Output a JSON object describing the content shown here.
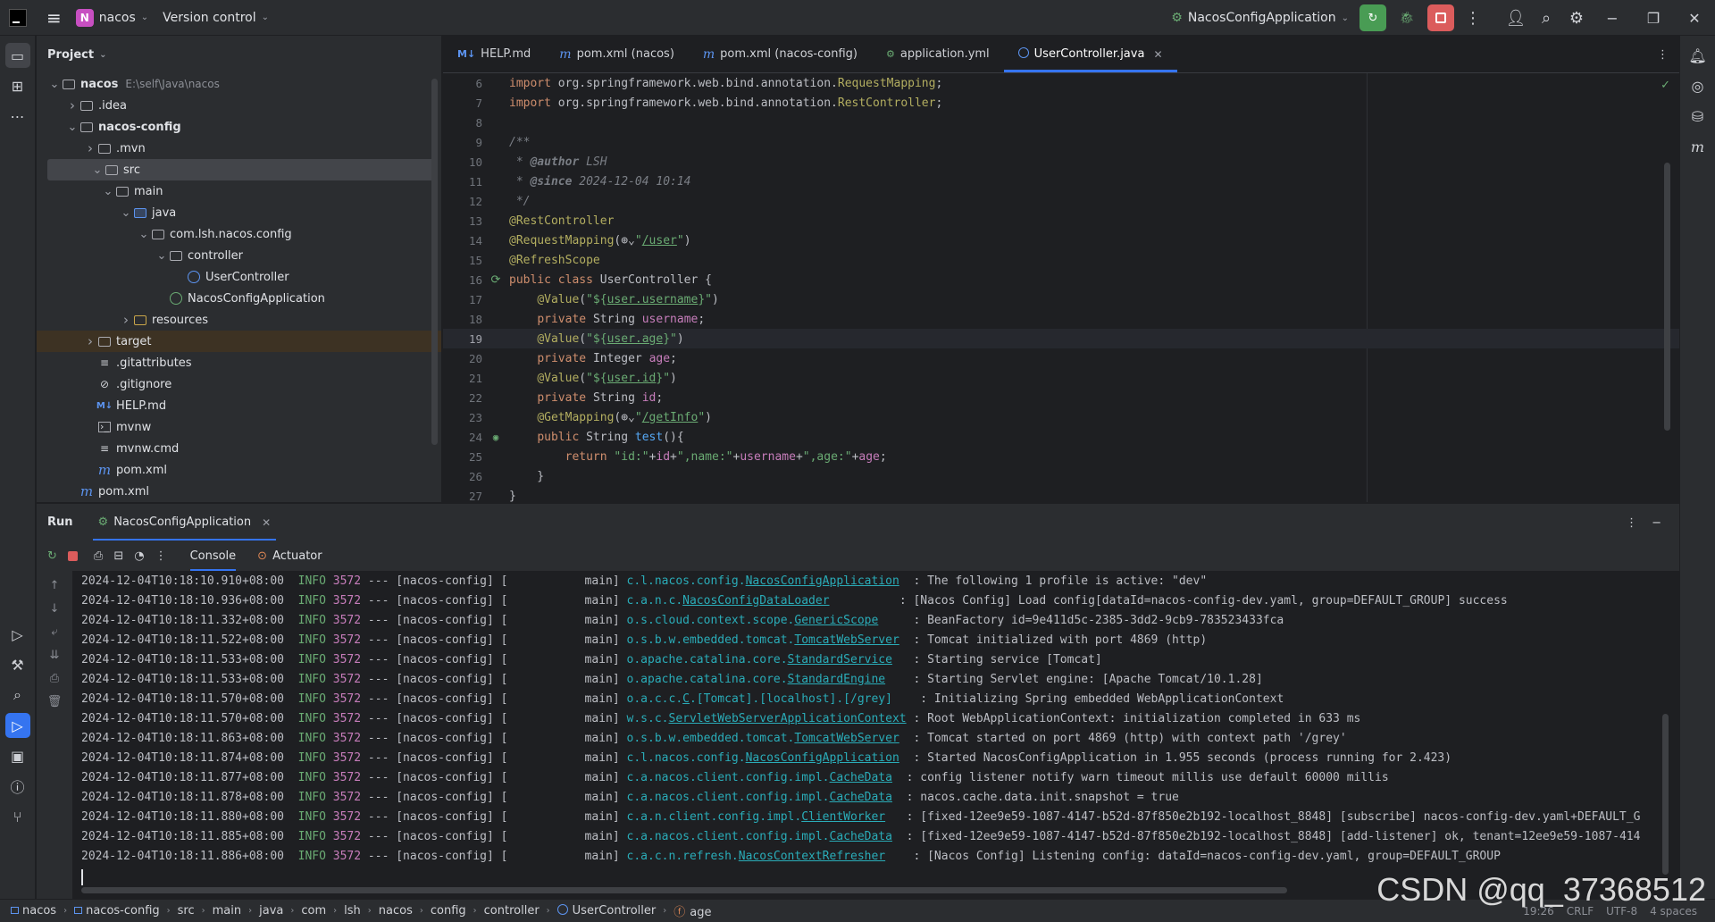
{
  "titlebar": {
    "project_badge": "N",
    "project_name": "nacos",
    "vcs": "Version control",
    "run_config": "NacosConfigApplication"
  },
  "project_panel": {
    "title": "Project",
    "tree": [
      {
        "label": "nacos",
        "hint": "E:\\self\\Java\\nacos",
        "depth": 0,
        "arrow": "open",
        "icon": "module-folder",
        "bold": true
      },
      {
        "label": ".idea",
        "depth": 1,
        "arrow": "closed",
        "icon": "folder"
      },
      {
        "label": "nacos-config",
        "depth": 1,
        "arrow": "open",
        "icon": "module-folder",
        "bold": true
      },
      {
        "label": ".mvn",
        "depth": 2,
        "arrow": "closed",
        "icon": "folder"
      },
      {
        "label": "src",
        "depth": 2,
        "arrow": "open",
        "icon": "folder",
        "selected": true
      },
      {
        "label": "main",
        "depth": 3,
        "arrow": "open",
        "icon": "folder"
      },
      {
        "label": "java",
        "depth": 4,
        "arrow": "open",
        "icon": "source-folder"
      },
      {
        "label": "com.lsh.nacos.config",
        "depth": 5,
        "arrow": "open",
        "icon": "package"
      },
      {
        "label": "controller",
        "depth": 6,
        "arrow": "open",
        "icon": "package"
      },
      {
        "label": "UserController",
        "depth": 7,
        "arrow": "",
        "icon": "class"
      },
      {
        "label": "NacosConfigApplication",
        "depth": 6,
        "arrow": "",
        "icon": "spring-class"
      },
      {
        "label": "resources",
        "depth": 4,
        "arrow": "closed",
        "icon": "resources-folder"
      },
      {
        "label": "target",
        "depth": 2,
        "arrow": "closed",
        "icon": "folder",
        "excluded": true
      },
      {
        "label": ".gitattributes",
        "depth": 2,
        "arrow": "",
        "icon": "text-file"
      },
      {
        "label": ".gitignore",
        "depth": 2,
        "arrow": "",
        "icon": "ignore-file"
      },
      {
        "label": "HELP.md",
        "depth": 2,
        "arrow": "",
        "icon": "markdown-file"
      },
      {
        "label": "mvnw",
        "depth": 2,
        "arrow": "",
        "icon": "script-file"
      },
      {
        "label": "mvnw.cmd",
        "depth": 2,
        "arrow": "",
        "icon": "text-file"
      },
      {
        "label": "pom.xml",
        "depth": 2,
        "arrow": "",
        "icon": "maven-file"
      },
      {
        "label": "pom.xml",
        "depth": 1,
        "arrow": "",
        "icon": "maven-file"
      }
    ]
  },
  "editor": {
    "tabs": [
      {
        "label": "HELP.md",
        "icon": "M↓",
        "active": false
      },
      {
        "label": "pom.xml (nacos)",
        "icon": "m",
        "active": false
      },
      {
        "label": "pom.xml (nacos-config)",
        "icon": "m",
        "active": false
      },
      {
        "label": "application.yml",
        "icon": "yml",
        "active": false
      },
      {
        "label": "UserController.java",
        "icon": "class",
        "active": true
      }
    ],
    "lines": [
      {
        "n": "6",
        "parts": [
          [
            "kw",
            "import "
          ],
          [
            "plain",
            "org.springframework.web.bind.annotation."
          ],
          [
            "ann",
            "RequestMapping"
          ],
          [
            "plain",
            ";"
          ]
        ]
      },
      {
        "n": "7",
        "parts": [
          [
            "kw",
            "import "
          ],
          [
            "plain",
            "org.springframework.web.bind.annotation."
          ],
          [
            "ann",
            "RestController"
          ],
          [
            "plain",
            ";"
          ]
        ]
      },
      {
        "n": "8",
        "parts": []
      },
      {
        "n": "9",
        "parts": [
          [
            "cmt",
            "/**"
          ]
        ]
      },
      {
        "n": "10",
        "parts": [
          [
            "cmt",
            " * "
          ],
          [
            "tag",
            "@author"
          ],
          [
            "cmt",
            " LSH"
          ]
        ]
      },
      {
        "n": "11",
        "parts": [
          [
            "cmt",
            " * "
          ],
          [
            "tag",
            "@since"
          ],
          [
            "cmt",
            " 2024-12-04 10:14"
          ]
        ]
      },
      {
        "n": "12",
        "parts": [
          [
            "cmt",
            " */"
          ]
        ]
      },
      {
        "n": "13",
        "parts": [
          [
            "ann",
            "@RestController"
          ]
        ]
      },
      {
        "n": "14",
        "parts": [
          [
            "ann",
            "@RequestMapping"
          ],
          [
            "plain",
            "(⊕⌄"
          ],
          [
            "str",
            "\""
          ],
          [
            "str link",
            "/user"
          ],
          [
            "str",
            "\""
          ],
          [
            "plain",
            ")"
          ]
        ]
      },
      {
        "n": "15",
        "parts": [
          [
            "ann",
            "@RefreshScope"
          ]
        ]
      },
      {
        "n": "16",
        "gutter": "bean",
        "parts": [
          [
            "kw",
            "public class "
          ],
          [
            "plain",
            "UserController {"
          ]
        ]
      },
      {
        "n": "17",
        "parts": [
          [
            "plain",
            "    "
          ],
          [
            "ann",
            "@Value"
          ],
          [
            "plain",
            "("
          ],
          [
            "str",
            "\"${"
          ],
          [
            "str link",
            "user.username"
          ],
          [
            "str",
            "}\""
          ],
          [
            "plain",
            ")"
          ]
        ]
      },
      {
        "n": "18",
        "parts": [
          [
            "plain",
            "    "
          ],
          [
            "kw",
            "private "
          ],
          [
            "plain",
            "String "
          ],
          [
            "fld",
            "username"
          ],
          [
            "plain",
            ";"
          ]
        ]
      },
      {
        "n": "19",
        "current": true,
        "parts": [
          [
            "plain",
            "    "
          ],
          [
            "ann",
            "@Value"
          ],
          [
            "plain",
            "("
          ],
          [
            "str",
            "\"${"
          ],
          [
            "str link",
            "user.age"
          ],
          [
            "str",
            "}\""
          ],
          [
            "plain",
            ")"
          ]
        ]
      },
      {
        "n": "20",
        "parts": [
          [
            "plain",
            "    "
          ],
          [
            "kw",
            "private "
          ],
          [
            "plain",
            "Integer "
          ],
          [
            "fld",
            "age"
          ],
          [
            "plain",
            ";"
          ]
        ]
      },
      {
        "n": "21",
        "parts": [
          [
            "plain",
            "    "
          ],
          [
            "ann",
            "@Value"
          ],
          [
            "plain",
            "("
          ],
          [
            "str",
            "\"${"
          ],
          [
            "str link",
            "user.id"
          ],
          [
            "str",
            "}\""
          ],
          [
            "plain",
            ")"
          ]
        ]
      },
      {
        "n": "22",
        "parts": [
          [
            "plain",
            "    "
          ],
          [
            "kw",
            "private "
          ],
          [
            "plain",
            "String "
          ],
          [
            "fld",
            "id"
          ],
          [
            "plain",
            ";"
          ]
        ]
      },
      {
        "n": "23",
        "parts": [
          [
            "plain",
            "    "
          ],
          [
            "ann",
            "@GetMapping"
          ],
          [
            "plain",
            "(⊕⌄"
          ],
          [
            "str",
            "\""
          ],
          [
            "str link",
            "/getInfo"
          ],
          [
            "str",
            "\""
          ],
          [
            "plain",
            ")"
          ]
        ]
      },
      {
        "n": "24",
        "gutter": "endpoint",
        "parts": [
          [
            "plain",
            "    "
          ],
          [
            "kw",
            "public "
          ],
          [
            "plain",
            "String "
          ],
          [
            "fn",
            "test"
          ],
          [
            "plain",
            "(){"
          ]
        ]
      },
      {
        "n": "25",
        "parts": [
          [
            "plain",
            "        "
          ],
          [
            "kw",
            "return "
          ],
          [
            "str",
            "\"id:\""
          ],
          [
            "plain",
            "+"
          ],
          [
            "fld",
            "id"
          ],
          [
            "plain",
            "+"
          ],
          [
            "str",
            "\",name:\""
          ],
          [
            "plain",
            "+"
          ],
          [
            "fld",
            "username"
          ],
          [
            "plain",
            "+"
          ],
          [
            "str",
            "\",age:\""
          ],
          [
            "plain",
            "+"
          ],
          [
            "fld",
            "age"
          ],
          [
            "plain",
            ";"
          ]
        ]
      },
      {
        "n": "26",
        "parts": [
          [
            "plain",
            "    }"
          ]
        ]
      },
      {
        "n": "27",
        "parts": [
          [
            "plain",
            "}"
          ]
        ]
      }
    ]
  },
  "run": {
    "title": "Run",
    "tab": "NacosConfigApplication",
    "console_tab": "Console",
    "actuator_tab": "Actuator",
    "logs": [
      {
        "ts": "2024-12-04T10:18:10.910+08:00",
        "lvl": "INFO",
        "pid": "3572",
        "app": "--- [nacos-config] [",
        "thread": "           main]",
        "pre": "c.l.nacos.config.",
        "cls": "NacosConfigApplication",
        "pad": "  ",
        "msg": ": The following 1 profile is active: \"dev\""
      },
      {
        "ts": "2024-12-04T10:18:10.936+08:00",
        "lvl": "INFO",
        "pid": "3572",
        "app": "--- [nacos-config] [",
        "thread": "           main]",
        "pre": "c.a.n.c.",
        "cls": "NacosConfigDataLoader",
        "pad": "          ",
        "msg": ": [Nacos Config] Load config[dataId=nacos-config-dev.yaml, group=DEFAULT_GROUP] success"
      },
      {
        "ts": "2024-12-04T10:18:11.332+08:00",
        "lvl": "INFO",
        "pid": "3572",
        "app": "--- [nacos-config] [",
        "thread": "           main]",
        "pre": "o.s.cloud.context.scope.",
        "cls": "GenericScope",
        "pad": "     ",
        "msg": ": BeanFactory id=9e411d5c-2385-3dd2-9cb9-783523433fca"
      },
      {
        "ts": "2024-12-04T10:18:11.522+08:00",
        "lvl": "INFO",
        "pid": "3572",
        "app": "--- [nacos-config] [",
        "thread": "           main]",
        "pre": "o.s.b.w.embedded.tomcat.",
        "cls": "TomcatWebServer",
        "pad": "  ",
        "msg": ": Tomcat initialized with port 4869 (http)"
      },
      {
        "ts": "2024-12-04T10:18:11.533+08:00",
        "lvl": "INFO",
        "pid": "3572",
        "app": "--- [nacos-config] [",
        "thread": "           main]",
        "pre": "o.apache.catalina.core.",
        "cls": "StandardService",
        "pad": "   ",
        "msg": ": Starting service [Tomcat]"
      },
      {
        "ts": "2024-12-04T10:18:11.533+08:00",
        "lvl": "INFO",
        "pid": "3572",
        "app": "--- [nacos-config] [",
        "thread": "           main]",
        "pre": "o.apache.catalina.core.",
        "cls": "StandardEngine",
        "pad": "    ",
        "msg": ": Starting Servlet engine: [Apache Tomcat/10.1.28]"
      },
      {
        "ts": "2024-12-04T10:18:11.570+08:00",
        "lvl": "INFO",
        "pid": "3572",
        "app": "--- [nacos-config] [",
        "thread": "           main]",
        "pre": "o.a.c.c.",
        "cls": "C",
        "post": ".[Tomcat].[localhost].[/grey]",
        "pad": "    ",
        "msg": ": Initializing Spring embedded WebApplicationContext"
      },
      {
        "ts": "2024-12-04T10:18:11.570+08:00",
        "lvl": "INFO",
        "pid": "3572",
        "app": "--- [nacos-config] [",
        "thread": "           main]",
        "pre": "w.s.c.",
        "cls": "ServletWebServerApplicationContext",
        "pad": " ",
        "msg": ": Root WebApplicationContext: initialization completed in 633 ms"
      },
      {
        "ts": "2024-12-04T10:18:11.863+08:00",
        "lvl": "INFO",
        "pid": "3572",
        "app": "--- [nacos-config] [",
        "thread": "           main]",
        "pre": "o.s.b.w.embedded.tomcat.",
        "cls": "TomcatWebServer",
        "pad": "  ",
        "msg": ": Tomcat started on port 4869 (http) with context path '/grey'"
      },
      {
        "ts": "2024-12-04T10:18:11.874+08:00",
        "lvl": "INFO",
        "pid": "3572",
        "app": "--- [nacos-config] [",
        "thread": "           main]",
        "pre": "c.l.nacos.config.",
        "cls": "NacosConfigApplication",
        "pad": "  ",
        "msg": ": Started NacosConfigApplication in 1.955 seconds (process running for 2.423)"
      },
      {
        "ts": "2024-12-04T10:18:11.877+08:00",
        "lvl": "INFO",
        "pid": "3572",
        "app": "--- [nacos-config] [",
        "thread": "           main]",
        "pre": "c.a.nacos.client.config.impl.",
        "cls": "CacheData",
        "pad": "  ",
        "msg": ": config listener notify warn timeout millis use default 60000 millis"
      },
      {
        "ts": "2024-12-04T10:18:11.878+08:00",
        "lvl": "INFO",
        "pid": "3572",
        "app": "--- [nacos-config] [",
        "thread": "           main]",
        "pre": "c.a.nacos.client.config.impl.",
        "cls": "CacheData",
        "pad": "  ",
        "msg": ": nacos.cache.data.init.snapshot = true"
      },
      {
        "ts": "2024-12-04T10:18:11.880+08:00",
        "lvl": "INFO",
        "pid": "3572",
        "app": "--- [nacos-config] [",
        "thread": "           main]",
        "pre": "c.a.n.client.config.impl.",
        "cls": "ClientWorker",
        "pad": "   ",
        "msg": ": [fixed-12ee9e59-1087-4147-b52d-87f850e2b192-localhost_8848] [subscribe] nacos-config-dev.yaml+DEFAULT_G"
      },
      {
        "ts": "2024-12-04T10:18:11.885+08:00",
        "lvl": "INFO",
        "pid": "3572",
        "app": "--- [nacos-config] [",
        "thread": "           main]",
        "pre": "c.a.nacos.client.config.impl.",
        "cls": "CacheData",
        "pad": "  ",
        "msg": ": [fixed-12ee9e59-1087-4147-b52d-87f850e2b192-localhost_8848] [add-listener] ok, tenant=12ee9e59-1087-414"
      },
      {
        "ts": "2024-12-04T10:18:11.886+08:00",
        "lvl": "INFO",
        "pid": "3572",
        "app": "--- [nacos-config] [",
        "thread": "           main]",
        "pre": "c.a.c.n.refresh.",
        "cls": "NacosContextRefresher",
        "pad": "    ",
        "msg": ": [Nacos Config] Listening config: dataId=nacos-config-dev.yaml, group=DEFAULT_GROUP"
      }
    ]
  },
  "statusbar": {
    "breadcrumbs": [
      "nacos",
      "nacos-config",
      "src",
      "main",
      "java",
      "com",
      "lsh",
      "nacos",
      "config",
      "controller",
      "UserController",
      "age"
    ],
    "position": "19:26",
    "line_sep": "CRLF",
    "encoding": "UTF-8",
    "indent": "4 spaces"
  },
  "watermark": "CSDN @qq_37368512",
  "colors": {
    "accent": "#3574f0",
    "run_green": "#499c54",
    "stop_red": "#db5c5c"
  }
}
